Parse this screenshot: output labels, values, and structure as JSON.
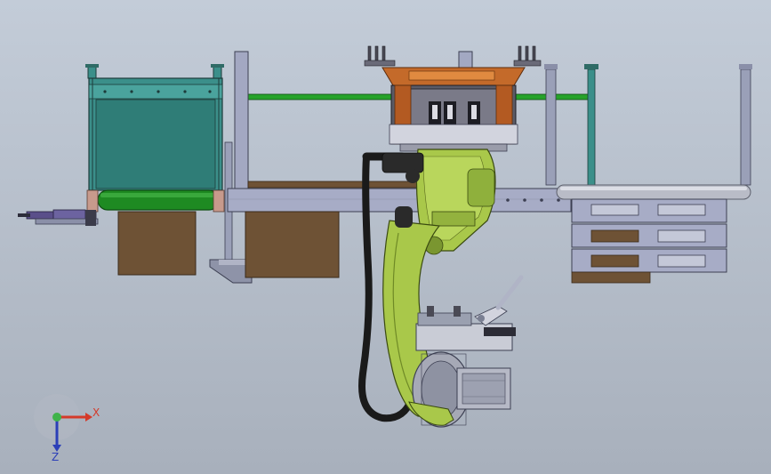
{
  "view": {
    "background_top": "#c3ccd8",
    "background_bottom": "#a8b0bc"
  },
  "triad": {
    "x_label": "X",
    "z_label": "Z",
    "x_color": "#d43a2a",
    "y_color": "#3fb34a",
    "z_color": "#2b3fb8"
  },
  "colors": {
    "robot_green": "#a9c84a",
    "robot_green_dark": "#6f8a26",
    "conveyor_teal": "#3b8f8a",
    "belt_green": "#1e8a22",
    "frame_steel": "#9aa0b8",
    "wood_brown": "#6e5235",
    "gripper_orange": "#c46a2a",
    "cable_black": "#1a1a1a"
  }
}
